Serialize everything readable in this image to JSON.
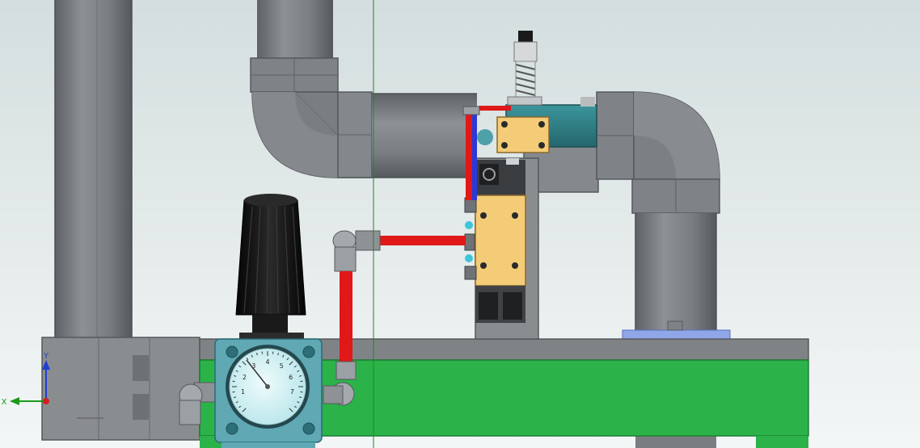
{
  "viewport": {
    "background_top": "#d4dede",
    "background_bottom": "#f3f6f6"
  },
  "triad": {
    "y_label": "Y",
    "x_label": "X",
    "y_color": "#1f3fd0",
    "x_color": "#1a9a1a",
    "origin_color": "#d42020"
  },
  "gauge": {
    "scale_labels": [
      "1",
      "2",
      "3",
      "4",
      "5",
      "6",
      "7"
    ]
  },
  "colors": {
    "pipe_gray": "#7d8185",
    "base_green": "#2bb34a",
    "base_top": "#808386",
    "air_line_red": "#e01818",
    "air_line_blue": "#2a3ad8",
    "valve_body": "#f4cc78",
    "solenoid_teal": "#2f7f86",
    "regulator_knob": "#141414",
    "gauge_face": "#d8f3f5",
    "gauge_bezel": "#5fa8b4",
    "pad_blue": "#8fa6e8",
    "axis_line_green": "#1c8a1c"
  }
}
